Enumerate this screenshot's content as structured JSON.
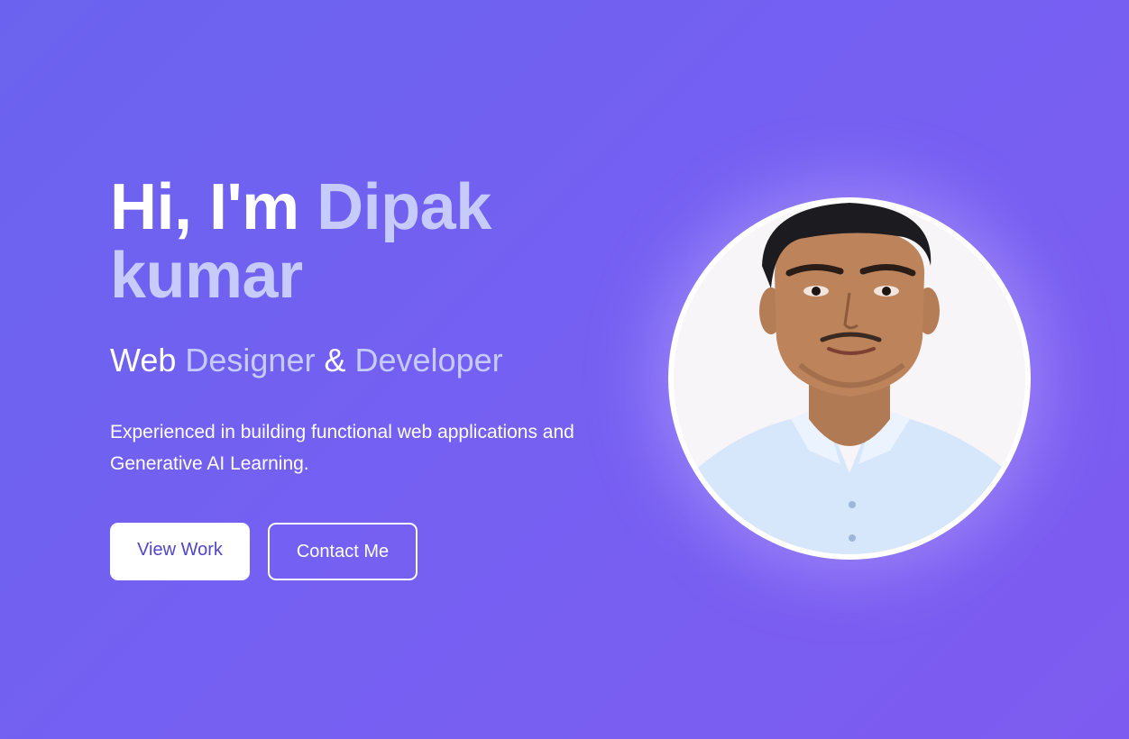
{
  "hero": {
    "greeting": "Hi, I'm",
    "name": "Dipak kumar",
    "role_part1": "Web",
    "role_part2": "Designer",
    "role_part3": "&",
    "role_part4": "Developer",
    "description": "Experienced in building functional web applications and Generative AI Learning.",
    "primary_button": "View Work",
    "secondary_button": "Contact Me"
  },
  "colors": {
    "background_start": "#6b63ef",
    "background_end": "#7e5bf0",
    "accent_text": "#c6cbfb",
    "primary_button_text": "#4f46c9"
  },
  "icons": {
    "profile_photo": "profile-photo"
  }
}
